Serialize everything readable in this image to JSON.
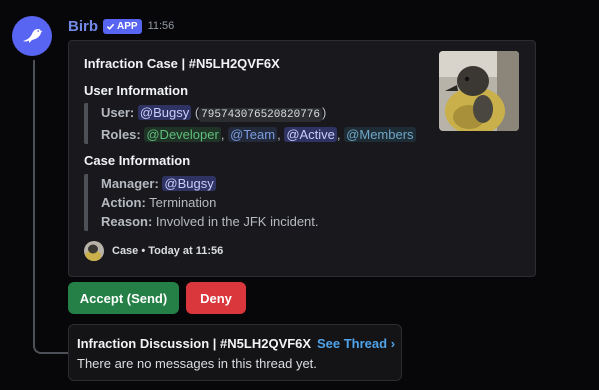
{
  "message": {
    "author": "Birb",
    "app_badge": "APP",
    "timestamp": "11:56"
  },
  "embed": {
    "title": "Infraction Case | #N5LH2QVF6X",
    "user_info": {
      "heading": "User Information",
      "user_key": "User:",
      "user_mention": "@Bugsy",
      "user_id_open": "(",
      "user_id": "795743076520820776",
      "user_id_close": ")",
      "roles_key": "Roles:",
      "roles": [
        "@Developer",
        "@Team",
        "@Active",
        "@Members"
      ],
      "role_sep": ","
    },
    "case_info": {
      "heading": "Case Information",
      "manager_key": "Manager:",
      "manager_mention": "@Bugsy",
      "action_key": "Action:",
      "action_value": "Termination",
      "reason_key": "Reason:",
      "reason_value": "Involved in the JFK incident."
    },
    "footer": "Case • Today at 11:56"
  },
  "buttons": {
    "accept": "Accept (Send)",
    "deny": "Deny"
  },
  "thread": {
    "title": "Infraction Discussion | #N5LH2QVF6X",
    "see_thread": "See Thread ›",
    "empty_message": "There are no messages in this thread yet."
  },
  "colors": {
    "brand": "#5865f2",
    "username": "#7289e6",
    "accept": "#248046",
    "deny": "#da373c",
    "link": "#4fa3e8"
  },
  "icons": {
    "avatar": "bird-icon",
    "badge": "check-icon"
  }
}
